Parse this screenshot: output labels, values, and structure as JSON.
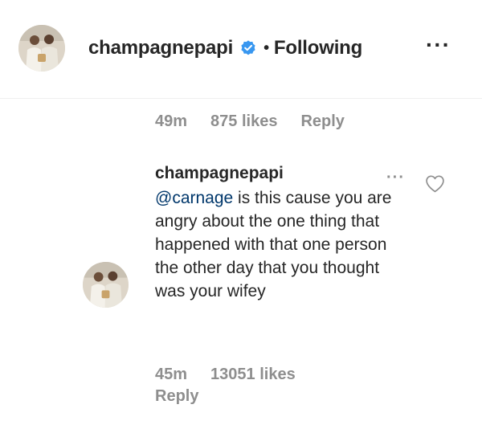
{
  "header": {
    "username": "champagnepapi",
    "separator": "•",
    "follow_status": "Following",
    "more_label": "···",
    "verified_icon": "verified-badge-icon",
    "verified_color": "#3897f0"
  },
  "top_meta": {
    "time": "49m",
    "likes": "875 likes",
    "reply": "Reply"
  },
  "comment": {
    "username": "champagnepapi",
    "mention": "@carnage",
    "text": " is this cause you are angry about the one thing that happened with that one person the other day that you thought was your wifey",
    "more_label": "···",
    "time": "45m",
    "likes": "13051 likes",
    "reply": "Reply"
  },
  "colors": {
    "text": "#262626",
    "muted": "#8e8e8e",
    "mention": "#00376b"
  }
}
